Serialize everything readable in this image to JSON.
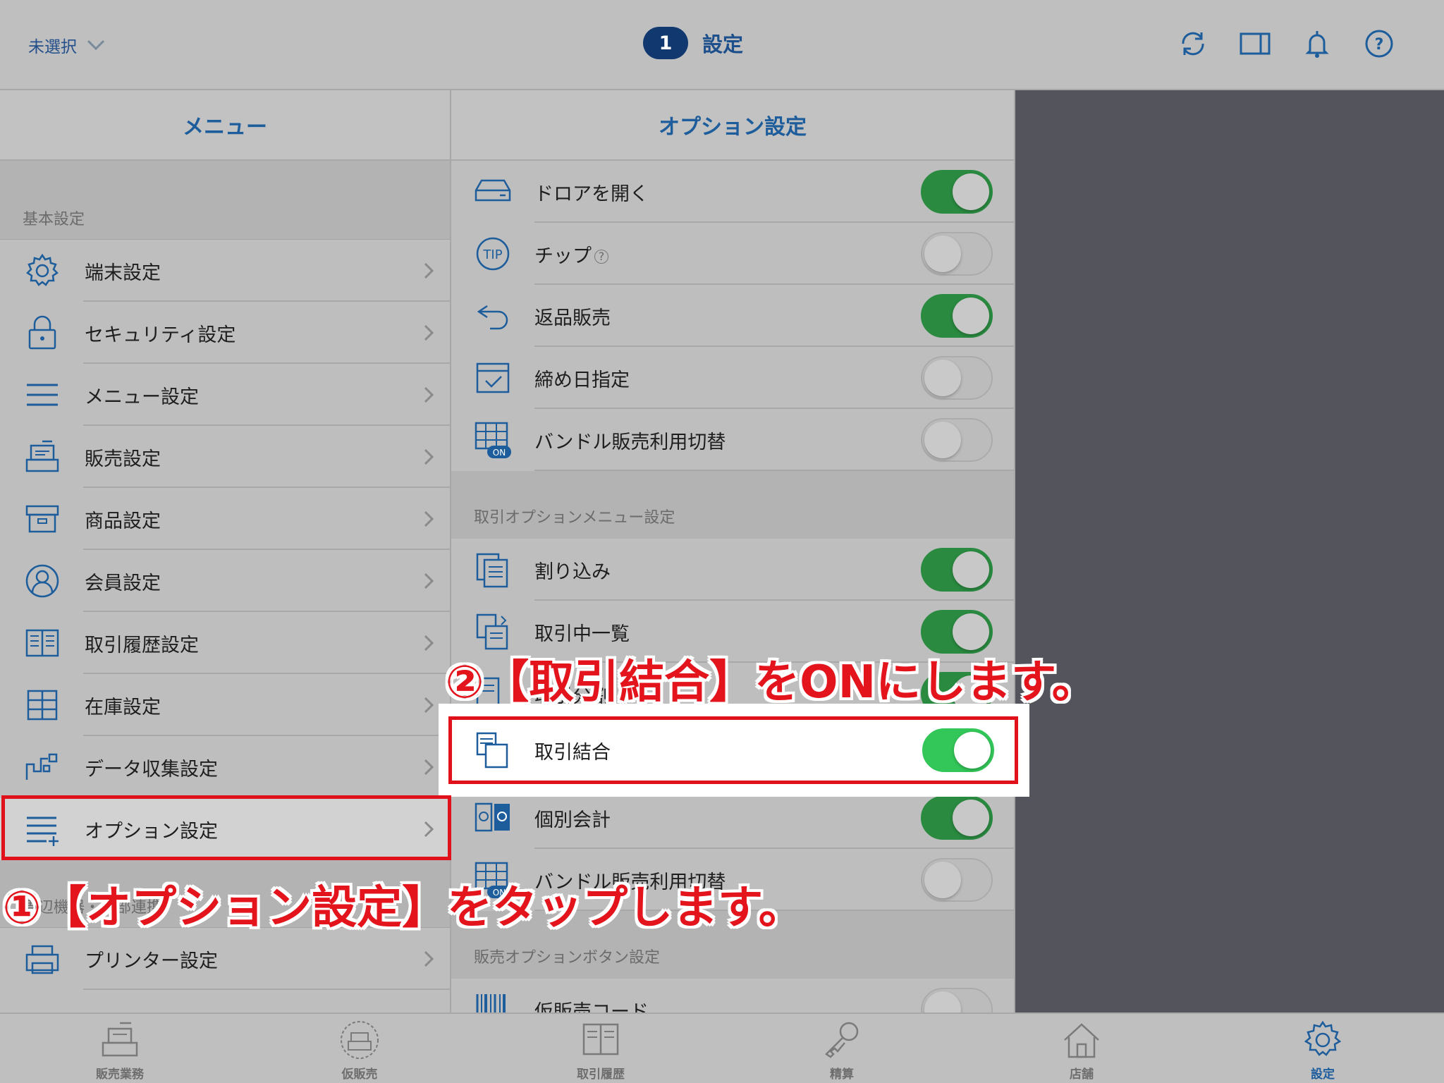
{
  "colors": {
    "accent": "#1d5d9b",
    "toggle_on": "#2a8a40",
    "toggle_on_bright": "#33c659",
    "annotation_red": "#e3141c"
  },
  "topbar": {
    "store_select": "未選択",
    "badge": "1",
    "title": "設定",
    "icons": [
      "refresh-icon",
      "split-view-icon",
      "bell-icon",
      "help-icon"
    ]
  },
  "menu": {
    "header": "メニュー",
    "section_basic": "基本設定",
    "items": [
      {
        "label": "端末設定",
        "icon": "gear-icon"
      },
      {
        "label": "セキュリティ設定",
        "icon": "lock-icon"
      },
      {
        "label": "メニュー設定",
        "icon": "menu-lines-icon"
      },
      {
        "label": "販売設定",
        "icon": "register-icon"
      },
      {
        "label": "商品設定",
        "icon": "box-icon"
      },
      {
        "label": "会員設定",
        "icon": "user-icon"
      },
      {
        "label": "取引履歴設定",
        "icon": "book-icon"
      },
      {
        "label": "在庫設定",
        "icon": "shelves-icon"
      },
      {
        "label": "データ収集設定",
        "icon": "data-icon"
      },
      {
        "label": "オプション設定",
        "icon": "list-plus-icon"
      }
    ],
    "section_external": "周辺機器・外部連携",
    "items2": [
      {
        "label": "プリンター設定",
        "icon": "printer-icon"
      }
    ]
  },
  "options": {
    "header": "オプション設定",
    "rows_top": [
      {
        "label": "ドロアを開く",
        "icon": "drawer-icon",
        "on": true
      },
      {
        "label": "チップ",
        "icon": "tip-icon",
        "on": false
      },
      {
        "label": "返品販売",
        "icon": "return-icon",
        "on": true
      },
      {
        "label": "締め日指定",
        "icon": "calendar-icon",
        "on": false
      },
      {
        "label": "バンドル販売利用切替",
        "icon": "bundle-icon",
        "on": false
      }
    ],
    "section_txn": "取引オプションメニュー設定",
    "rows_txn": [
      {
        "label": "割り込み",
        "icon": "docs-icon",
        "on": true
      },
      {
        "label": "取引中一覧",
        "icon": "doc-list-icon",
        "on": true
      },
      {
        "label": "取引分割",
        "icon": "doc-split-icon",
        "on": true
      },
      {
        "label": "取引結合",
        "icon": "doc-merge-icon",
        "on": true
      },
      {
        "label": "個別会計",
        "icon": "split-pay-icon",
        "on": true
      },
      {
        "label": "バンドル販売利用切替",
        "icon": "bundle-icon",
        "on": false
      }
    ],
    "section_sales": "販売オプションボタン設定",
    "rows_sales": [
      {
        "label": "仮販売コード",
        "icon": "barcode-icon",
        "on": false
      }
    ]
  },
  "annotations": {
    "step1": "①【オプション設定】をタップします。",
    "step2": "②【取引結合】をONにします。"
  },
  "tabbar": {
    "tabs": [
      {
        "label": "販売業務",
        "icon": "register-icon"
      },
      {
        "label": "仮販売",
        "icon": "temp-register-icon"
      },
      {
        "label": "取引履歴",
        "icon": "book-icon"
      },
      {
        "label": "精算",
        "icon": "key-icon"
      },
      {
        "label": "店舗",
        "icon": "home-icon"
      },
      {
        "label": "設定",
        "icon": "gear-icon"
      }
    ]
  }
}
